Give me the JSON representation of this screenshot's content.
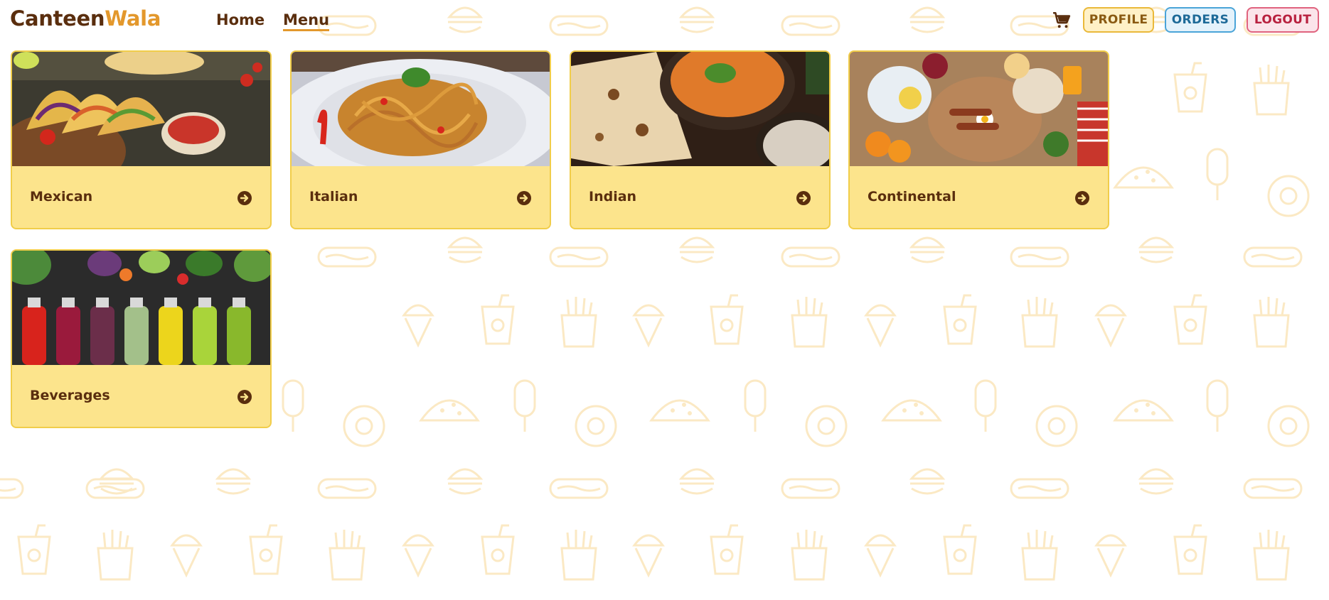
{
  "brand": {
    "part1": "Canteen",
    "part2": "Wala"
  },
  "nav": {
    "home": "Home",
    "menu": "Menu"
  },
  "header_icons": {
    "cart": "cart-icon"
  },
  "buttons": {
    "profile": "PROFILE",
    "orders": "ORDERS",
    "logout": "LOGOUT"
  },
  "categories": [
    {
      "name": "Mexican",
      "image": "tacos-photo"
    },
    {
      "name": "Italian",
      "image": "pasta-photo"
    },
    {
      "name": "Indian",
      "image": "curry-photo"
    },
    {
      "name": "Continental",
      "image": "breakfast-photo"
    },
    {
      "name": "Beverages",
      "image": "juice-bottles-photo"
    }
  ],
  "colors": {
    "brand_dark": "#5a2e0e",
    "brand_accent": "#e3982c",
    "card_bg": "#fce48c",
    "card_border": "#f1cd4a",
    "pattern": "#fbe9c4"
  }
}
